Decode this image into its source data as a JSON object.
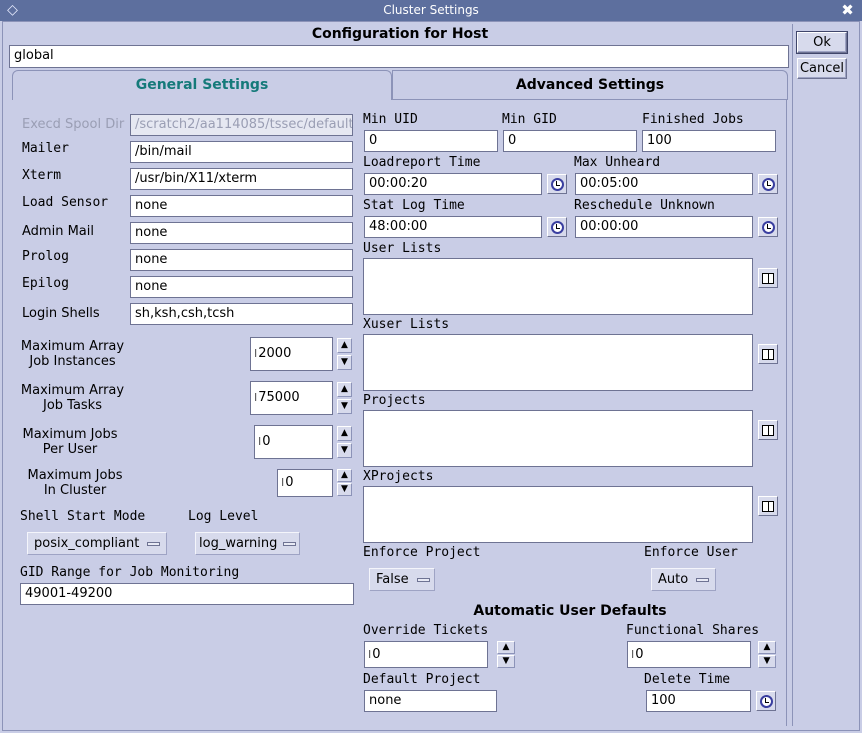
{
  "window": {
    "title": "Cluster Settings"
  },
  "dialog": {
    "heading": "Configuration for Host",
    "host": "global",
    "ok_label": "Ok",
    "cancel_label": "Cancel"
  },
  "tabs": {
    "general": "General Settings",
    "advanced": "Advanced Settings"
  },
  "general": {
    "execd_spool_dir_label": "Execd Spool Dir",
    "execd_spool_dir": "/scratch2/aa114085/tssec/default",
    "mailer_label": "Mailer",
    "mailer": "/bin/mail",
    "xterm_label": "Xterm",
    "xterm": "/usr/bin/X11/xterm",
    "load_sensor_label": "Load Sensor",
    "load_sensor": "none",
    "admin_mail_label": "Admin Mail",
    "admin_mail": "none",
    "prolog_label": "Prolog",
    "prolog": "none",
    "epilog_label": "Epilog",
    "epilog": "none",
    "login_shells_label": "Login Shells",
    "login_shells": "sh,ksh,csh,tcsh",
    "max_array_instances_label1": "Maximum Array",
    "max_array_instances_label2": "Job Instances",
    "max_array_instances": "2000",
    "max_array_tasks_label1": "Maximum Array",
    "max_array_tasks_label2": "Job Tasks",
    "max_array_tasks": "75000",
    "max_jobs_user_label1": "Maximum Jobs",
    "max_jobs_user_label2": "Per User",
    "max_jobs_user": "0",
    "max_jobs_cluster_label1": "Maximum Jobs",
    "max_jobs_cluster_label2": "In Cluster",
    "max_jobs_cluster": "0",
    "shell_start_mode_label": "Shell Start Mode",
    "shell_start_mode": "posix_compliant",
    "log_level_label": "Log Level",
    "log_level": "log_warning",
    "gid_range_label": "GID Range for Job Monitoring",
    "gid_range": "49001-49200"
  },
  "limits": {
    "min_uid_label": "Min UID",
    "min_uid": "0",
    "min_gid_label": "Min GID",
    "min_gid": "0",
    "finished_jobs_label": "Finished Jobs",
    "finished_jobs": "100",
    "loadreport_time_label": "Loadreport Time",
    "loadreport_time": "00:00:20",
    "max_unheard_label": "Max Unheard",
    "max_unheard": "00:05:00",
    "stat_log_time_label": "Stat Log Time",
    "stat_log_time": "48:00:00",
    "reschedule_unknown_label": "Reschedule Unknown",
    "reschedule_unknown": "00:00:00"
  },
  "lists": {
    "user_lists_label": "User Lists",
    "xuser_lists_label": "Xuser Lists",
    "projects_label": "Projects",
    "xprojects_label": "XProjects",
    "enforce_project_label": "Enforce Project",
    "enforce_project": "False",
    "enforce_user_label": "Enforce User",
    "enforce_user": "Auto"
  },
  "user_defaults": {
    "heading": "Automatic User Defaults",
    "override_tickets_label": "Override Tickets",
    "override_tickets": "0",
    "functional_shares_label": "Functional Shares",
    "functional_shares": "0",
    "default_project_label": "Default Project",
    "default_project": "none",
    "delete_time_label": "Delete Time",
    "delete_time": "100"
  },
  "colors": {
    "background": "#c9cde6",
    "titlebar": "#5d6f9e",
    "active_tab_text": "#157a7a",
    "icon_blue": "#3a3fa0"
  },
  "icons": [
    "window-menu-icon",
    "close-icon",
    "clock-icon",
    "list-edit-icon",
    "arrow-up-icon",
    "arrow-down-icon"
  ]
}
